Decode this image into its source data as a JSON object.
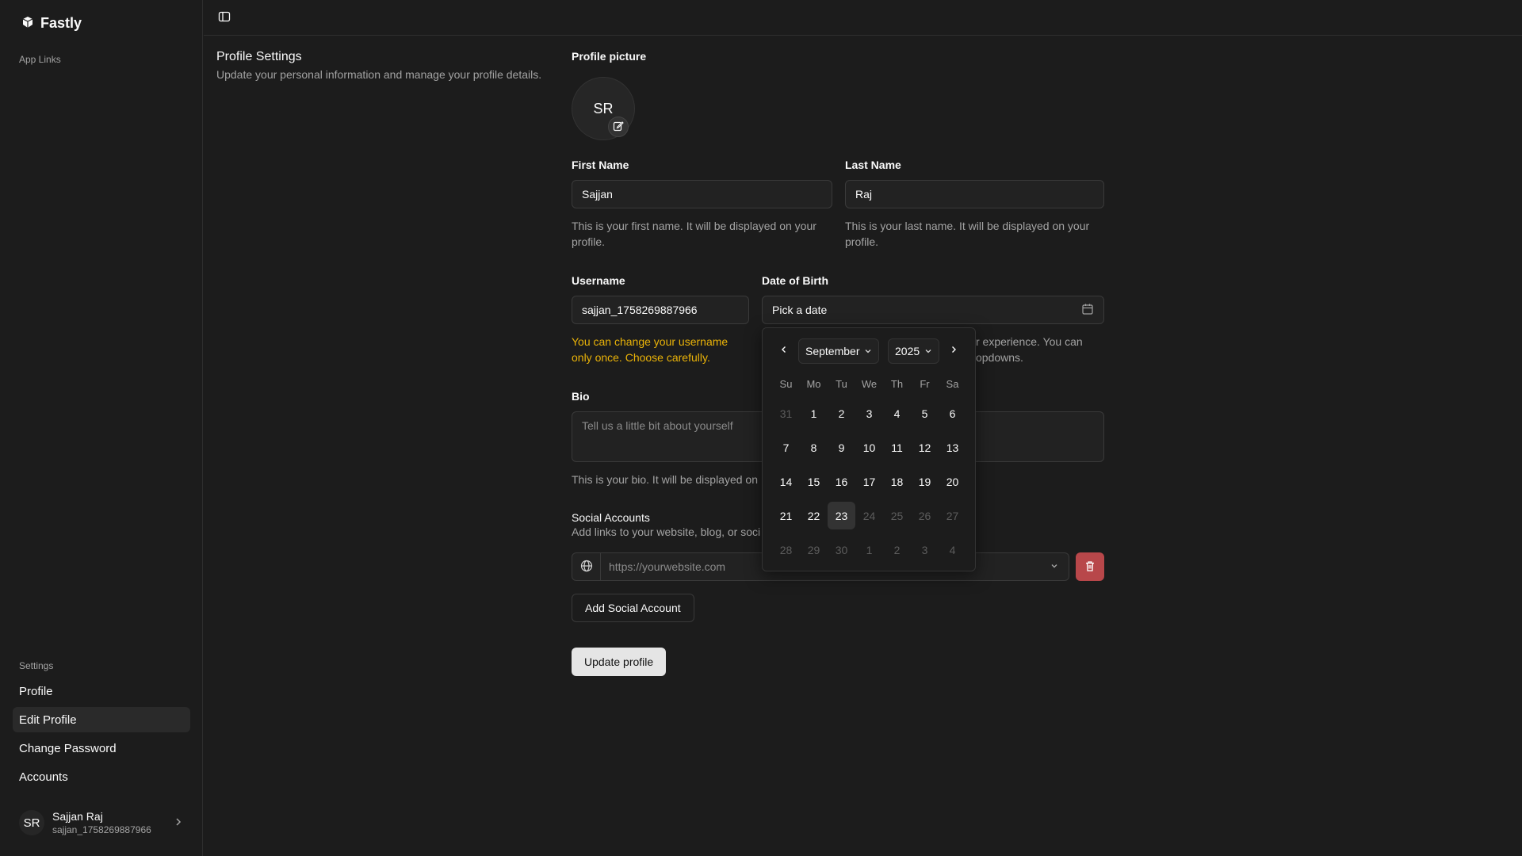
{
  "app": {
    "name": "Fastly"
  },
  "sidebar": {
    "app_links_label": "App Links",
    "settings_label": "Settings",
    "items": [
      {
        "label": "Profile",
        "active": false
      },
      {
        "label": "Edit Profile",
        "active": true
      },
      {
        "label": "Change Password",
        "active": false
      },
      {
        "label": "Accounts",
        "active": false
      }
    ],
    "user": {
      "initials": "SR",
      "name": "Sajjan Raj",
      "handle": "sajjan_1758269887966"
    }
  },
  "section": {
    "title": "Profile Settings",
    "description": "Update your personal information and manage your profile details."
  },
  "form": {
    "profile_picture_label": "Profile picture",
    "avatar_initials": "SR",
    "first_name": {
      "label": "First Name",
      "value": "Sajjan",
      "help": "This is your first name. It will be displayed on your profile."
    },
    "last_name": {
      "label": "Last Name",
      "value": "Raj",
      "help": "This is your last name. It will be displayed on your profile."
    },
    "username": {
      "label": "Username",
      "value": "sajjan_1758269887966",
      "warning": "You can change your username only once. Choose carefully."
    },
    "dob": {
      "label": "Date of Birth",
      "placeholder": "Pick a date",
      "help_visible_line1": "r experience. You can",
      "help_visible_line2": "opdowns."
    },
    "bio": {
      "label": "Bio",
      "placeholder": "Tell us a little bit about yourself",
      "help_visible": "This is your bio. It will be displayed on"
    },
    "social": {
      "title": "Social Accounts",
      "description_visible": "Add links to your website, blog, or soci",
      "url_placeholder": "https://yourwebsite.com",
      "add_label": "Add Social Account"
    },
    "submit_label": "Update profile"
  },
  "calendar": {
    "month": "September",
    "year": "2025",
    "weekdays": [
      "Su",
      "Mo",
      "Tu",
      "We",
      "Th",
      "Fr",
      "Sa"
    ],
    "days": [
      "31",
      "1",
      "2",
      "3",
      "4",
      "5",
      "6",
      "7",
      "8",
      "9",
      "10",
      "11",
      "12",
      "13",
      "14",
      "15",
      "16",
      "17",
      "18",
      "19",
      "20",
      "21",
      "22",
      "23",
      "24",
      "25",
      "26",
      "27",
      "28",
      "29",
      "30",
      "1",
      "2",
      "3",
      "4"
    ],
    "muted_indices": [
      0,
      24,
      25,
      26,
      27,
      28,
      29,
      30,
      31,
      32,
      33,
      34
    ],
    "today_index": 23
  },
  "colors": {
    "background": "#1c1c1c",
    "warning": "#eab308",
    "danger": "#b8474a",
    "primary_button": "#e5e5e5"
  }
}
